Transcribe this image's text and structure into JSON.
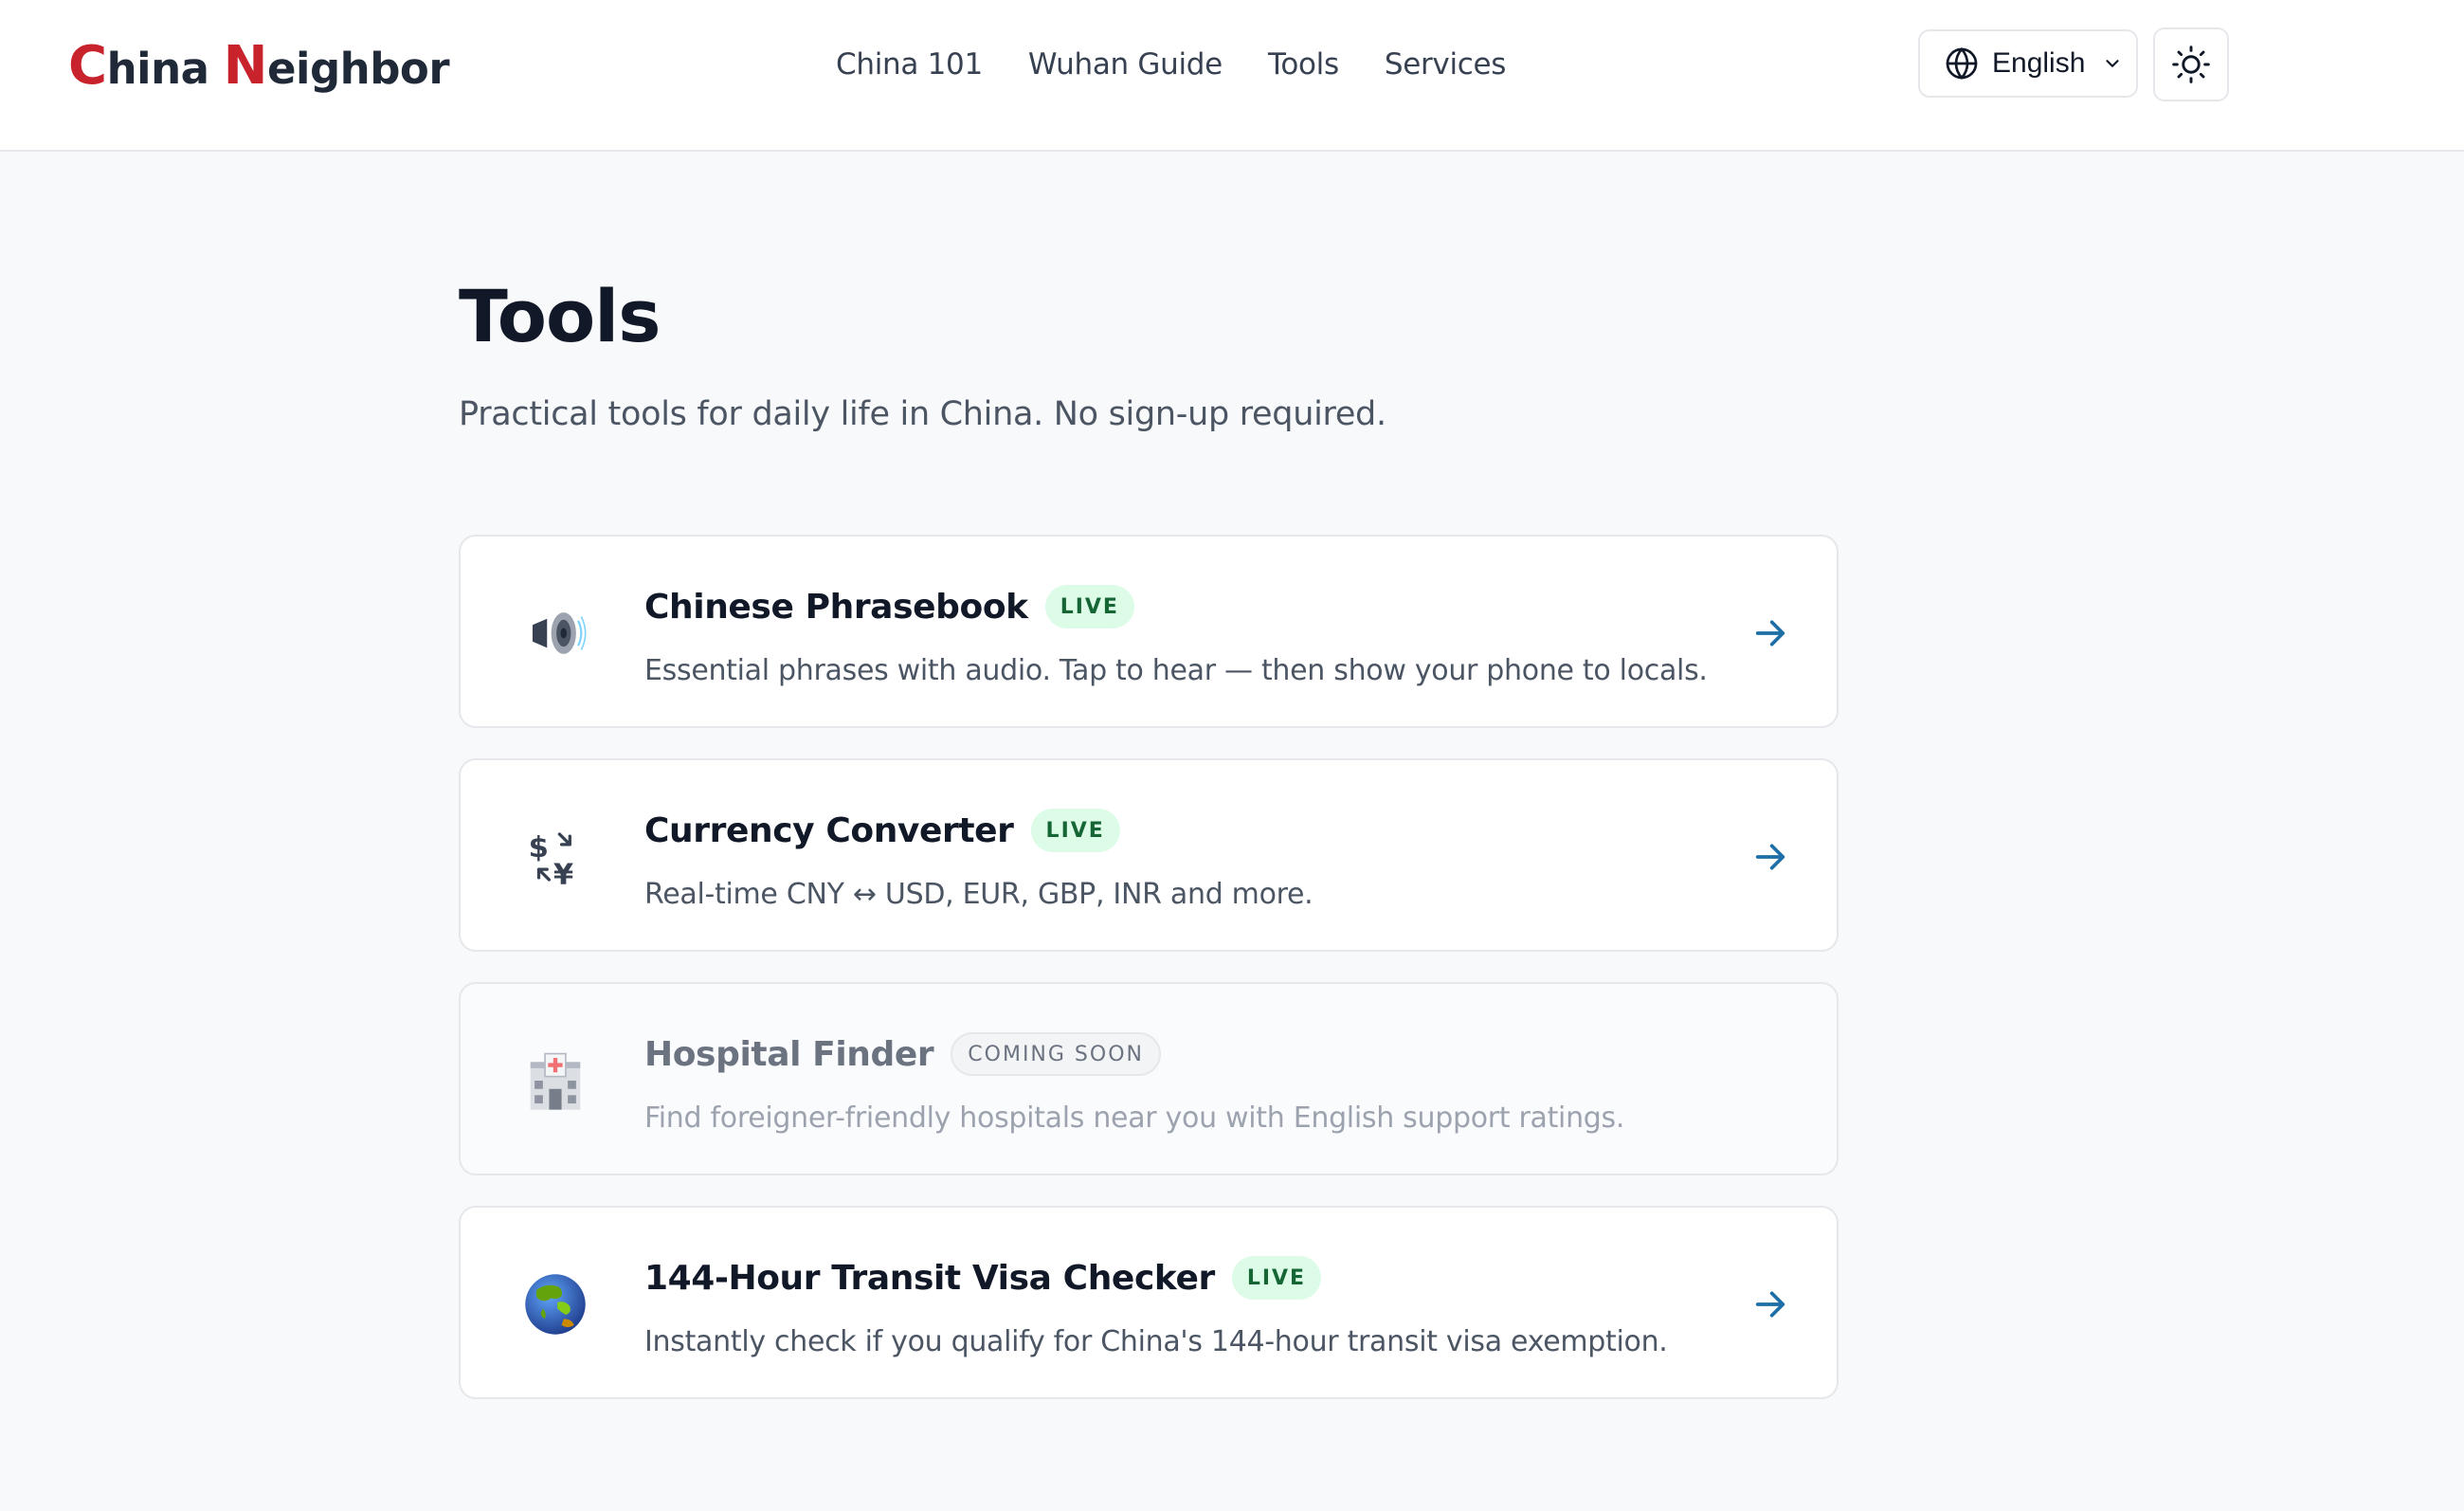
{
  "header": {
    "logo": {
      "c_cap": "C",
      "c_rest": "hina ",
      "n_cap": "N",
      "n_rest": "eighbor"
    },
    "nav": [
      "China 101",
      "Wuhan Guide",
      "Tools",
      "Services"
    ],
    "language": {
      "selected": "English",
      "icon": "globe-icon"
    },
    "theme_toggle": {
      "icon": "sun-icon"
    }
  },
  "main": {
    "title": "Tools",
    "subtitle": "Practical tools for daily life in China. No sign-up required.",
    "tools": [
      {
        "title": "Chinese Phrasebook",
        "badge": "LIVE",
        "status": "live",
        "description": "Essential phrases with audio. Tap to hear — then show your phone to locals.",
        "icon": "speaker-icon"
      },
      {
        "title": "Currency Converter",
        "badge": "LIVE",
        "status": "live",
        "description": "Real-time CNY ↔ USD, EUR, GBP, INR and more.",
        "icon": "currency-exchange-icon"
      },
      {
        "title": "Hospital Finder",
        "badge": "COMING SOON",
        "status": "coming-soon",
        "description": "Find foreigner-friendly hospitals near you with English support ratings.",
        "icon": "hospital-icon"
      },
      {
        "title": "144-Hour Transit Visa Checker",
        "badge": "LIVE",
        "status": "live",
        "description": "Instantly check if you qualify for China's 144-hour transit visa exemption.",
        "icon": "globe-asia-icon"
      }
    ]
  },
  "colors": {
    "brand_red": "#c8232c",
    "live_badge_bg": "#dcfce7",
    "live_badge_text": "#166534",
    "arrow_blue": "#1d6fa5",
    "page_bg": "#f8f9fb"
  }
}
